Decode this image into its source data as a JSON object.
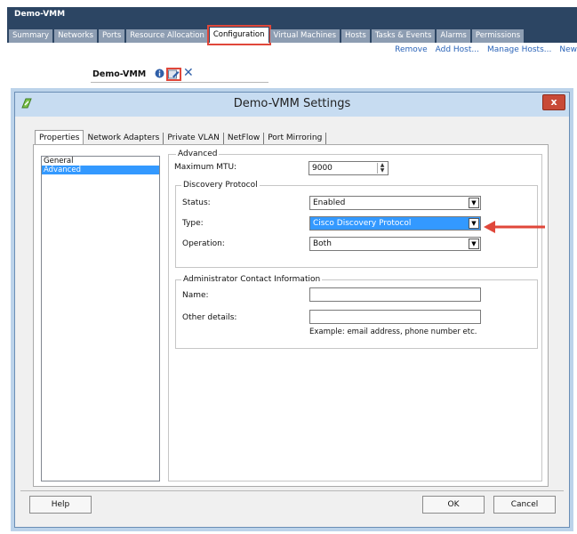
{
  "background": {
    "app_title": "Demo-VMM",
    "tabs": [
      "Summary",
      "Networks",
      "Ports",
      "Resource Allocation",
      "Configuration",
      "Virtual Machines",
      "Hosts",
      "Tasks & Events",
      "Alarms",
      "Permissions"
    ],
    "active_tab": "Configuration",
    "actions": [
      "Remove",
      "Add Host...",
      "Manage Hosts...",
      "New"
    ],
    "switch_name": "Demo-VMM"
  },
  "dialog": {
    "title": "Demo-VMM Settings",
    "close_label": "x",
    "tabs": [
      "Properties",
      "Network Adapters",
      "Private VLAN",
      "NetFlow",
      "Port Mirroring"
    ],
    "active_tab": "Properties",
    "nav_items": [
      "General",
      "Advanced"
    ],
    "selected_nav": "Advanced",
    "advanced": {
      "legend": "Advanced",
      "mtu_label": "Maximum MTU:",
      "mtu_value": "9000",
      "discovery": {
        "legend": "Discovery Protocol",
        "status_label": "Status:",
        "status_value": "Enabled",
        "type_label": "Type:",
        "type_value": "Cisco Discovery Protocol",
        "operation_label": "Operation:",
        "operation_value": "Both"
      },
      "contact": {
        "legend": "Administrator Contact Information",
        "name_label": "Name:",
        "name_value": "",
        "other_label": "Other details:",
        "other_value": "",
        "hint": "Example: email address, phone number etc."
      }
    },
    "buttons": {
      "help": "Help",
      "ok": "OK",
      "cancel": "Cancel"
    }
  },
  "colors": {
    "highlight": "#3399ff",
    "annotation": "#e0473a",
    "header": "#2c4563"
  }
}
